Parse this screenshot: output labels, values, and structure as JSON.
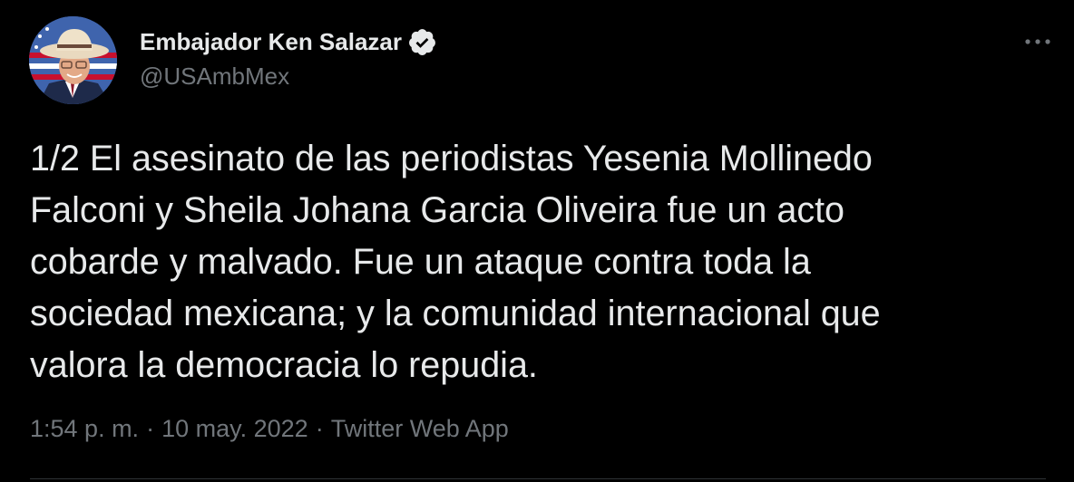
{
  "author": {
    "display_name": "Embajador Ken Salazar",
    "handle": "@USAmbMex",
    "verified": true
  },
  "tweet": {
    "lines": [
      "1/2 El asesinato de las periodistas Yesenia Mollinedo",
      "Falconi y Sheila Johana Garcia Oliveira fue un acto",
      "cobarde y malvado. Fue un ataque contra toda la",
      "sociedad mexicana; y la comunidad internacional que",
      "valora la democracia lo repudia."
    ]
  },
  "meta": {
    "time": "1:54 p. m.",
    "separator": "·",
    "date": "10 may. 2022",
    "source": "Twitter Web App"
  },
  "icons": {
    "verified": "verified-badge-icon",
    "more": "more-horizontal-icon"
  },
  "colors": {
    "background": "#000000",
    "text": "#e7e9ea",
    "secondary": "#71767b"
  }
}
